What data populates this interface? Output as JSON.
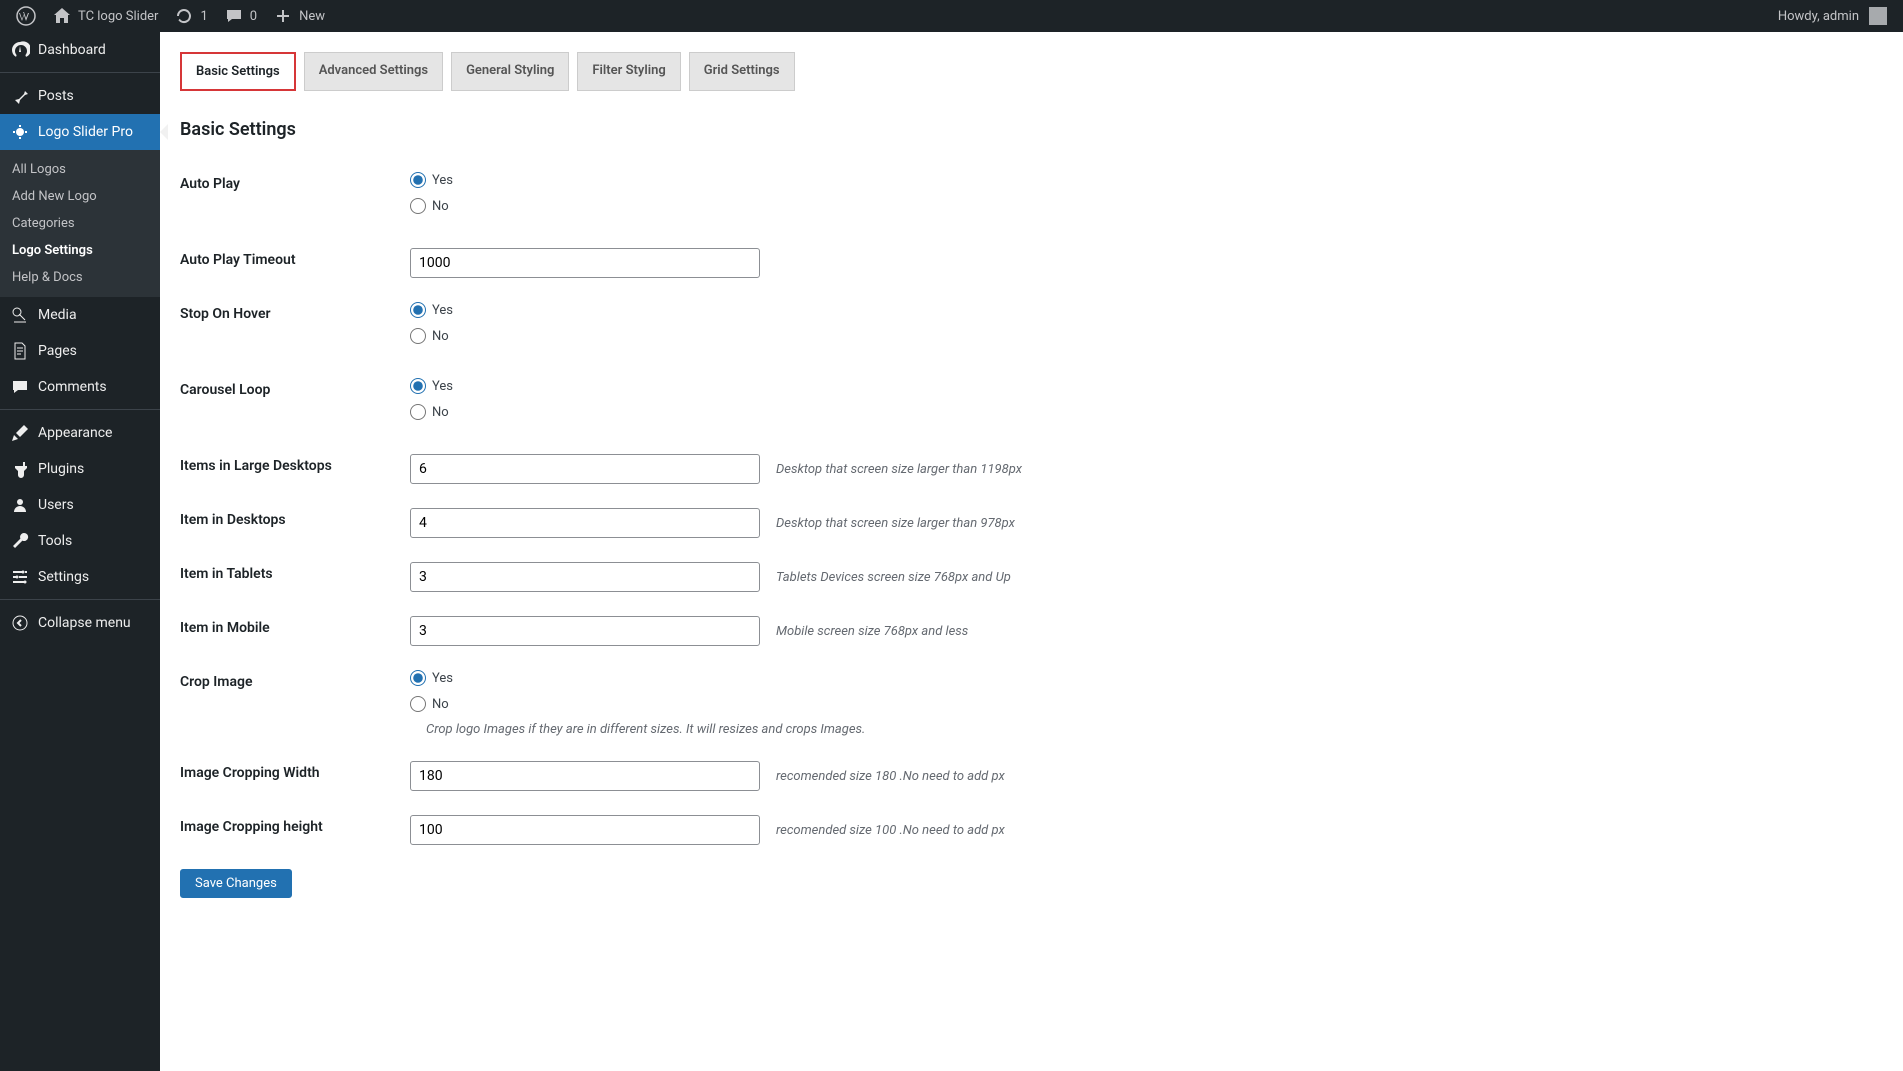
{
  "adminbar": {
    "site_name": "TC logo Slider",
    "updates": "1",
    "comments": "0",
    "new_label": "New",
    "howdy": "Howdy, admin"
  },
  "sidebar": {
    "dashboard": "Dashboard",
    "posts": "Posts",
    "logo_slider_pro": "Logo Slider Pro",
    "submenu": {
      "all_logos": "All Logos",
      "add_new_logo": "Add New Logo",
      "categories": "Categories",
      "logo_settings": "Logo Settings",
      "help_docs": "Help & Docs"
    },
    "media": "Media",
    "pages": "Pages",
    "comments": "Comments",
    "appearance": "Appearance",
    "plugins": "Plugins",
    "users": "Users",
    "tools": "Tools",
    "settings": "Settings",
    "collapse": "Collapse menu"
  },
  "tabs": {
    "basic": "Basic Settings",
    "advanced": "Advanced Settings",
    "general_styling": "General Styling",
    "filter_styling": "Filter Styling",
    "grid_settings": "Grid Settings"
  },
  "section_title": "Basic Settings",
  "form": {
    "auto_play": {
      "label": "Auto Play",
      "yes": "Yes",
      "no": "No",
      "value": "yes"
    },
    "auto_play_timeout": {
      "label": "Auto Play Timeout",
      "value": "1000"
    },
    "stop_on_hover": {
      "label": "Stop On Hover",
      "yes": "Yes",
      "no": "No",
      "value": "yes"
    },
    "carousel_loop": {
      "label": "Carousel Loop",
      "yes": "Yes",
      "no": "No",
      "value": "yes"
    },
    "items_large": {
      "label": "Items in Large Desktops",
      "value": "6",
      "desc": "Desktop that screen size larger than 1198px"
    },
    "items_desktop": {
      "label": "Item in Desktops",
      "value": "4",
      "desc": "Desktop that screen size larger than 978px"
    },
    "items_tablet": {
      "label": "Item in Tablets",
      "value": "3",
      "desc": "Tablets Devices screen size 768px and Up"
    },
    "items_mobile": {
      "label": "Item in Mobile",
      "value": "3",
      "desc": "Mobile screen size 768px and less"
    },
    "crop_image": {
      "label": "Crop Image",
      "yes": "Yes",
      "no": "No",
      "value": "yes",
      "desc": "Crop logo Images if they are in different sizes. It will resizes and crops Images."
    },
    "crop_width": {
      "label": "Image Cropping Width",
      "value": "180",
      "desc": "recomended size 180 .No need to add px"
    },
    "crop_height": {
      "label": "Image Cropping height",
      "value": "100",
      "desc": "recomended size 100 .No need to add px"
    },
    "save": "Save Changes"
  }
}
